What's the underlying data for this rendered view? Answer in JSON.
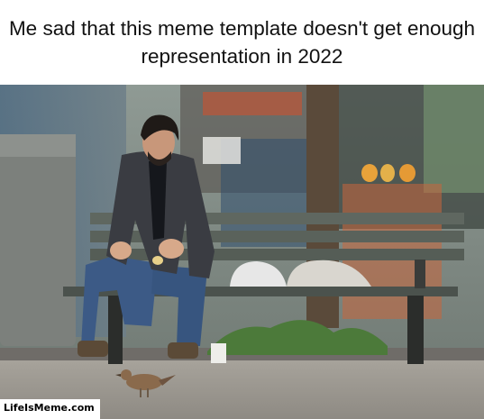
{
  "meme": {
    "caption": "Me sad that this meme template doesn't get enough representation in 2022",
    "template": "Sad Keanu",
    "watermark": "LifeIsMeme.com"
  }
}
